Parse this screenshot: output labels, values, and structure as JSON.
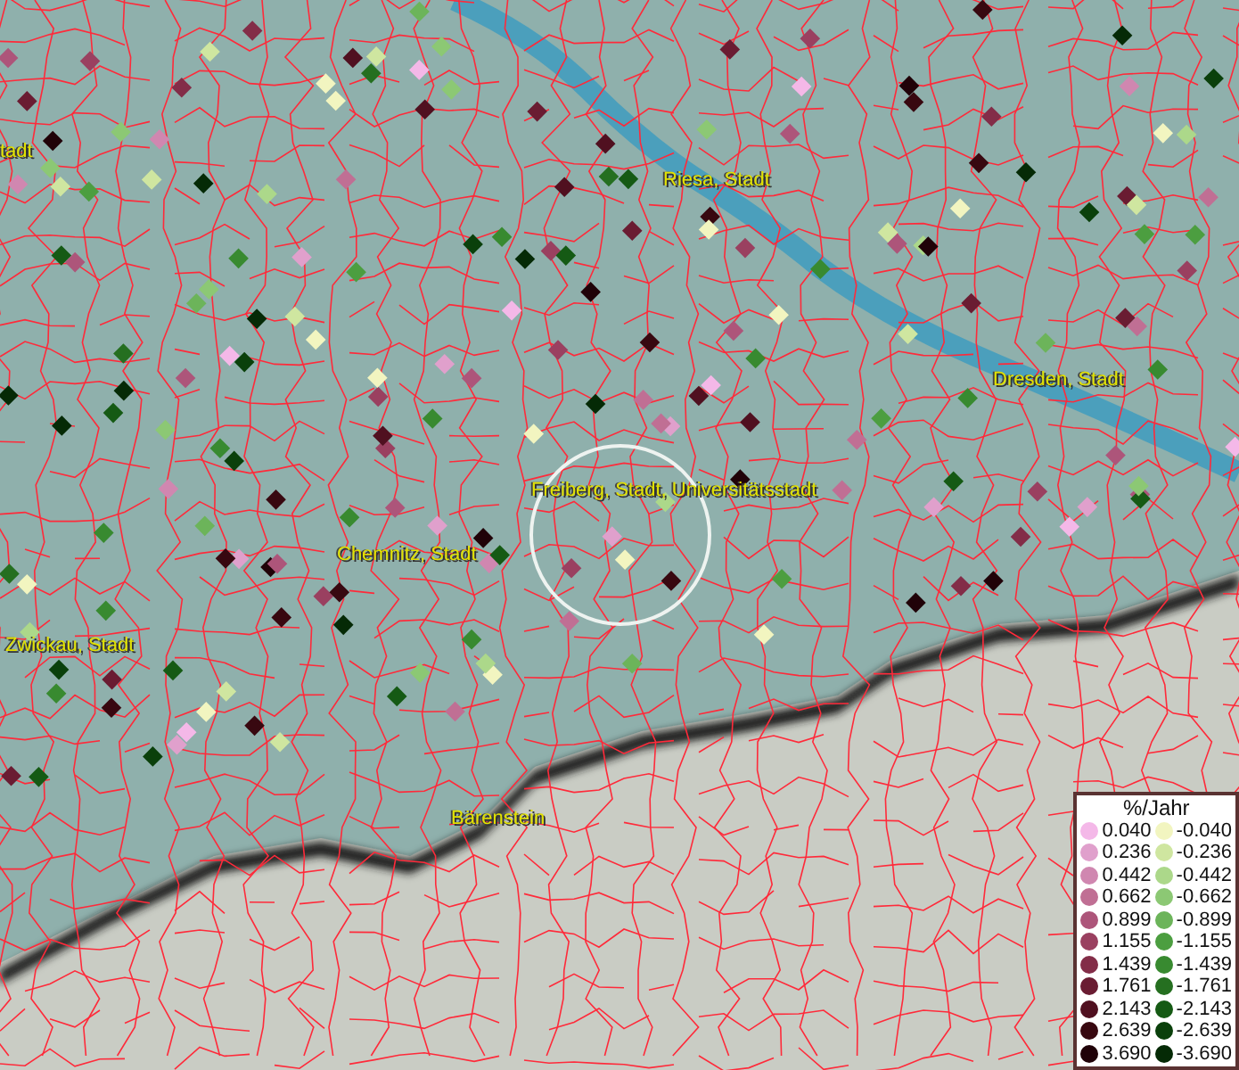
{
  "map": {
    "places": [
      {
        "name": "tadt"
      },
      {
        "name": "Riesa, Stadt"
      },
      {
        "name": "Dresden, Stadt"
      },
      {
        "name": "Freiberg, Stadt, Universitätsstadt"
      },
      {
        "name": "Chemnitz, Stadt"
      },
      {
        "name": "Zwickau, Stadt"
      },
      {
        "name": "Bärenstein"
      }
    ]
  },
  "legend": {
    "title": "%/Jahr",
    "left": [
      {
        "label": "0.040",
        "color": "#f4b8e8"
      },
      {
        "label": "0.236",
        "color": "#e0a0cc"
      },
      {
        "label": "0.442",
        "color": "#d087b0"
      },
      {
        "label": "0.662",
        "color": "#c06f94"
      },
      {
        "label": "0.899",
        "color": "#ad557a"
      },
      {
        "label": "1.155",
        "color": "#9a4060"
      },
      {
        "label": "1.439",
        "color": "#832d48"
      },
      {
        "label": "1.761",
        "color": "#6a1c32"
      },
      {
        "label": "2.143",
        "color": "#501020"
      },
      {
        "label": "2.639",
        "color": "#380810"
      },
      {
        "label": "3.690",
        "color": "#200208"
      }
    ],
    "right": [
      {
        "label": "-0.040",
        "color": "#f2f5c0"
      },
      {
        "label": "-0.236",
        "color": "#cfe6a0"
      },
      {
        "label": "-0.442",
        "color": "#acd88a"
      },
      {
        "label": "-0.662",
        "color": "#8cc874"
      },
      {
        "label": "-0.899",
        "color": "#6cb45a"
      },
      {
        "label": "-1.155",
        "color": "#4c9e40"
      },
      {
        "label": "-1.439",
        "color": "#388a30"
      },
      {
        "label": "-1.761",
        "color": "#256f20"
      },
      {
        "label": "-2.143",
        "color": "#155a14"
      },
      {
        "label": "-2.639",
        "color": "#0a400b"
      },
      {
        "label": "-3.690",
        "color": "#052a06"
      }
    ]
  }
}
